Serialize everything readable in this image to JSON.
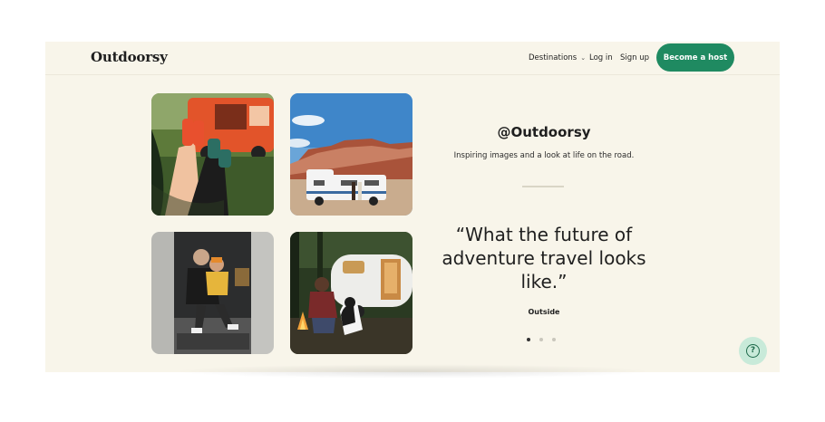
{
  "nav": {
    "logo": "Outdoorsy",
    "destinations": "Destinations",
    "login": "Log in",
    "signup": "Sign up",
    "become_host": "Become a host"
  },
  "hero": {
    "handle": "@Outdoorsy",
    "tagline": "Inspiring images and a look at life on the road.",
    "quote": "“What the future of adventure travel looks like.”",
    "source": "Outside"
  },
  "carousel": {
    "slides": 3,
    "active": 1
  },
  "icons": {
    "help": "help-question-icon",
    "chevron": "chevron-down-icon"
  },
  "colors": {
    "accent": "#1f8a61",
    "background": "#f8f5ea",
    "help_bg": "#c8ead9"
  }
}
